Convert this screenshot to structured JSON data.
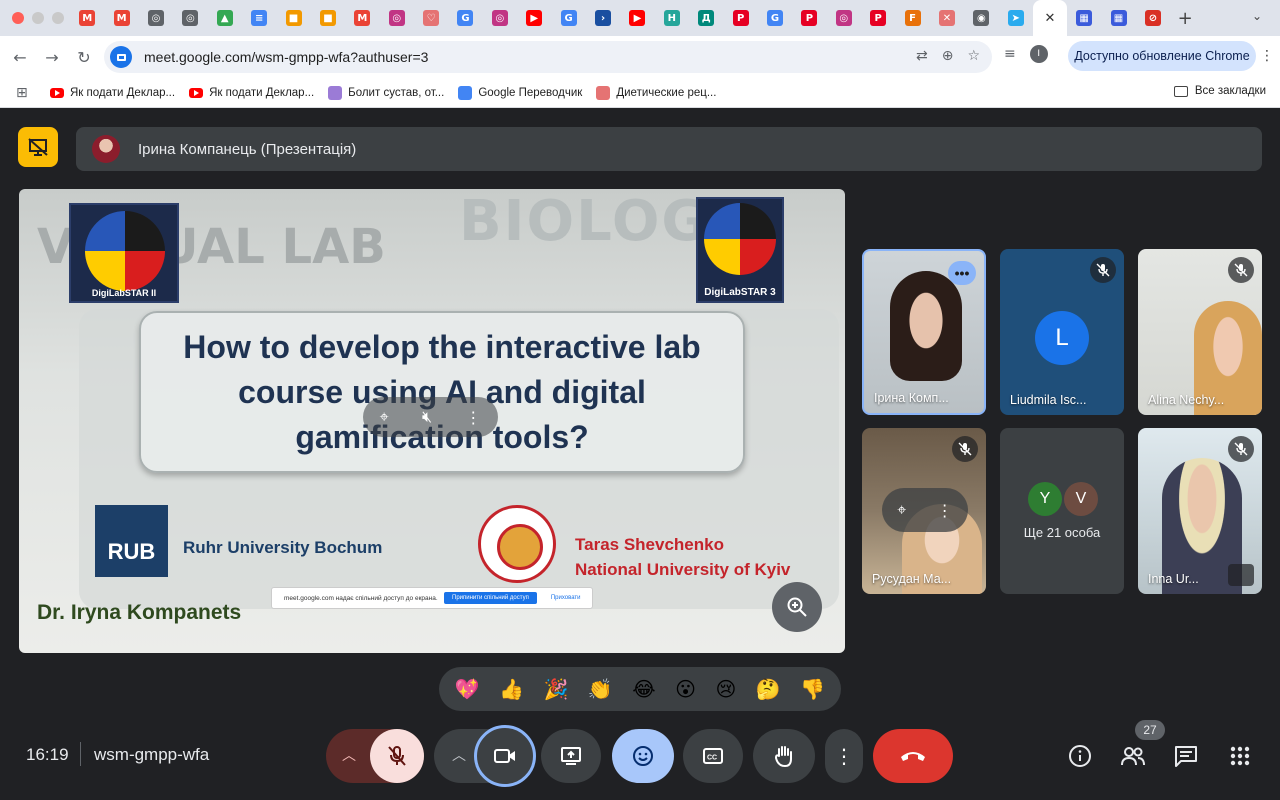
{
  "browser": {
    "tabs": [
      {
        "icon": "gmail-icon",
        "letter": "M",
        "color": "#ea4335"
      },
      {
        "icon": "gmail-icon",
        "letter": "M",
        "color": "#ea4335"
      },
      {
        "icon": "globe-icon",
        "letter": "◎",
        "color": "#5f6368"
      },
      {
        "icon": "globe-icon",
        "letter": "◎",
        "color": "#5f6368"
      },
      {
        "icon": "drive-icon",
        "letter": "▲",
        "color": "#34a853"
      },
      {
        "icon": "docs-icon",
        "letter": "≡",
        "color": "#4285f4"
      },
      {
        "icon": "orange-app-icon",
        "letter": "■",
        "color": "#f29900"
      },
      {
        "icon": "orange-app-icon",
        "letter": "■",
        "color": "#f29900"
      },
      {
        "icon": "gmail-icon",
        "letter": "M",
        "color": "#ea4335"
      },
      {
        "icon": "instagram-icon",
        "letter": "◎",
        "color": "#c13584"
      },
      {
        "icon": "heart-app-icon",
        "letter": "♡",
        "color": "#e57373"
      },
      {
        "icon": "google-icon",
        "letter": "G",
        "color": "#4285f4"
      },
      {
        "icon": "instagram-icon",
        "letter": "◎",
        "color": "#c13584"
      },
      {
        "icon": "youtube-icon",
        "letter": "▶",
        "color": "#ff0000"
      },
      {
        "icon": "google-icon",
        "letter": "G",
        "color": "#4285f4"
      },
      {
        "icon": "arrow-app-icon",
        "letter": "›",
        "color": "#1a4fa0"
      },
      {
        "icon": "youtube-icon",
        "letter": "▶",
        "color": "#ff0000"
      },
      {
        "icon": "h-app-icon",
        "letter": "H",
        "color": "#26a69a"
      },
      {
        "icon": "d-app-icon",
        "letter": "Д",
        "color": "#00897b"
      },
      {
        "icon": "pinterest-icon",
        "letter": "P",
        "color": "#e60023"
      },
      {
        "icon": "google-icon",
        "letter": "G",
        "color": "#4285f4"
      },
      {
        "icon": "pinterest-icon",
        "letter": "P",
        "color": "#e60023"
      },
      {
        "icon": "instagram-icon",
        "letter": "◎",
        "color": "#c13584"
      },
      {
        "icon": "pinterest-icon",
        "letter": "P",
        "color": "#e60023"
      },
      {
        "icon": "f-app-icon",
        "letter": "F",
        "color": "#e8710a"
      },
      {
        "icon": "diet-app-icon",
        "letter": "✕",
        "color": "#e57373"
      },
      {
        "icon": "chrome-icon",
        "letter": "◉",
        "color": "#5f6368"
      },
      {
        "icon": "telegram-icon",
        "letter": "➤",
        "color": "#2aabee"
      }
    ],
    "active_tab_close": "✕",
    "tabs_after": [
      {
        "icon": "grid-app-icon",
        "letter": "▦",
        "color": "#3b5bdb"
      },
      {
        "icon": "grid-app-icon",
        "letter": "▦",
        "color": "#3b5bdb"
      },
      {
        "icon": "blocked-icon",
        "letter": "⊘",
        "color": "#d93025"
      }
    ],
    "new_tab": "+",
    "url_domain": "meet.google.com",
    "url_path": "/wsm-gmpp-wfa?authuser=3",
    "update_button": "Доступно обновление Chrome",
    "profile_letter": "I"
  },
  "bookmarks": {
    "items": [
      {
        "label": "Як подати Деклар...",
        "type": "youtube"
      },
      {
        "label": "Як подати Деклар...",
        "type": "youtube"
      },
      {
        "label": "Болит сустав, от...",
        "type": "site",
        "color": "#9b7bd6"
      },
      {
        "label": "Google Переводчик",
        "type": "site",
        "color": "#4285f4"
      },
      {
        "label": "Диетические рец...",
        "type": "site",
        "color": "#e57373"
      }
    ],
    "all_bookmarks": "Все закладки"
  },
  "meet": {
    "presenter_label": "Ірина Компанець (Презентація)",
    "slide": {
      "bg_word_1": "BIOLOGY",
      "bg_word_2": "VIRTUAL LAB",
      "logo_left_caption": "DigiLabSTAR II",
      "logo_right_caption": "DigiLabSTAR 3",
      "title": "How to develop the interactive lab course using AI and digital gamification tools?",
      "rub_logo": "RUB",
      "rub_name": "Ruhr University Bochum",
      "knu_name_line1": "Taras Shevchenko",
      "knu_name_line2": "National University of Kyiv",
      "author": "Dr. Iryna Kompanets",
      "share_notice": "meet.google.com надає спільний доступ до екрана.",
      "share_stop": "Припинити спільний доступ",
      "share_hide": "Приховати"
    },
    "participants": [
      {
        "name": "Ірина Комп...",
        "kind": "video"
      },
      {
        "name": "Liudmila Isc...",
        "kind": "avatar",
        "initial": "L",
        "muted": true
      },
      {
        "name": "Alina Nechy...",
        "kind": "video",
        "muted": true
      },
      {
        "name": "Русудан Ма...",
        "kind": "video",
        "muted": true
      },
      {
        "name": "Ще 21 особа",
        "kind": "overflow",
        "initials": [
          "Y",
          "V"
        ]
      },
      {
        "name": "Inna Ur...",
        "kind": "video",
        "muted": true
      }
    ],
    "reactions": [
      "💖",
      "👍",
      "🎉",
      "👏",
      "😂",
      "😮",
      "😢",
      "🤔",
      "👎"
    ],
    "time": "16:19",
    "meeting_code": "wsm-gmpp-wfa",
    "participant_count": "27"
  }
}
